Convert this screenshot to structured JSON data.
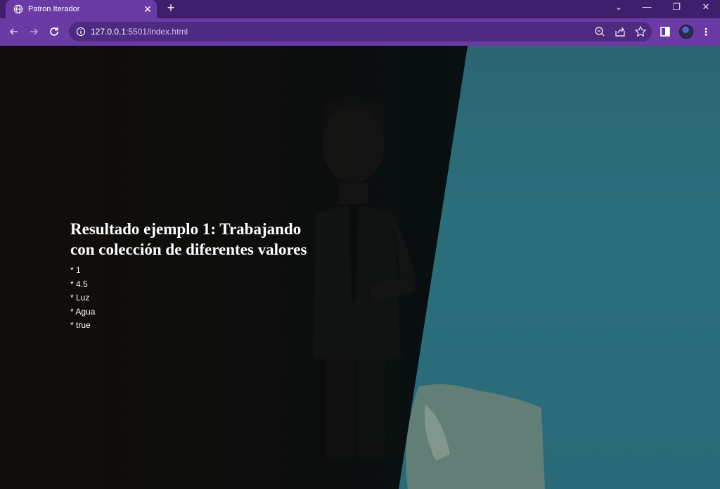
{
  "browser": {
    "tab_title": "Patron Iterador",
    "tab_close": "✕",
    "new_tab": "+",
    "url_host": "127.0.0.1",
    "url_rest": ":5501/index.html",
    "window_controls": {
      "dropdown": "⌄",
      "minimize": "—",
      "restore": "❐",
      "close": "✕"
    },
    "accent_color": "#6a3aa5"
  },
  "page": {
    "heading_line1": "Resultado ejemplo 1: Trabajando",
    "heading_line2": "con colección de diferentes valores",
    "items": [
      "* 1",
      "* 4.5",
      "* Luz",
      "* Agua",
      "* true"
    ]
  }
}
